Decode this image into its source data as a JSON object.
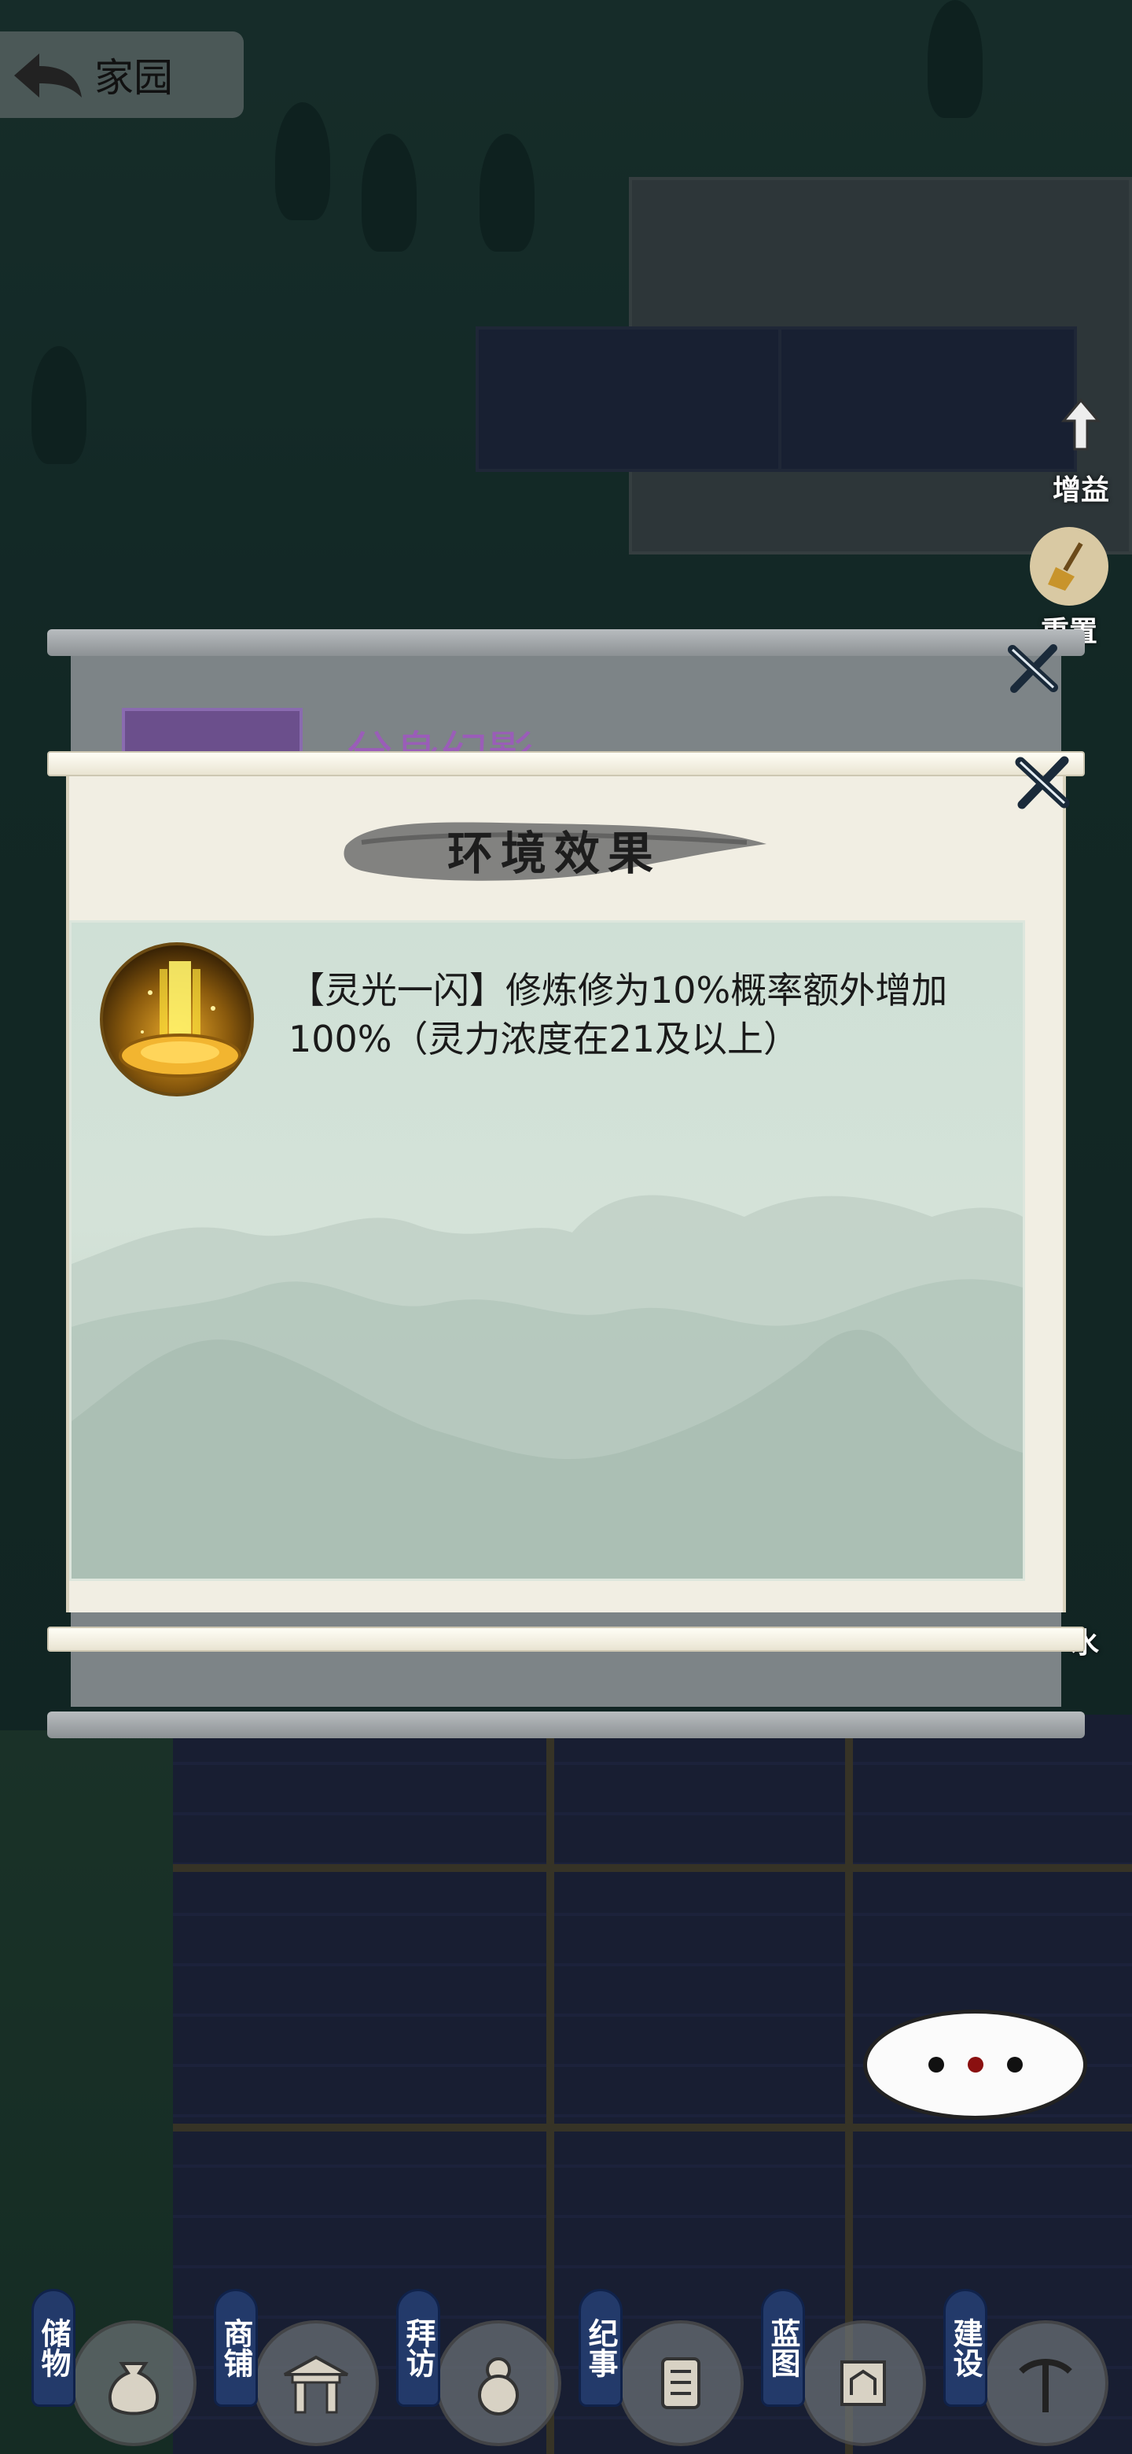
{
  "topbar": {
    "title": "家园"
  },
  "side_tools": {
    "buff_label": "增益",
    "reset_label": "重置",
    "water_label": "水"
  },
  "back_dialog": {
    "header_text": "分身幻影"
  },
  "dialog": {
    "title": "环境效果",
    "effect": {
      "icon": "golden-light-icon",
      "text": "【灵光一闪】修炼修为10%概率额外增加100%（灵力浓度在21及以上）"
    }
  },
  "bottom_nav": [
    {
      "label": "储物",
      "icon": "bag-icon"
    },
    {
      "label": "商铺",
      "icon": "shop-icon"
    },
    {
      "label": "拜访",
      "icon": "gourd-icon"
    },
    {
      "label": "纪事",
      "icon": "scroll-icon"
    },
    {
      "label": "蓝图",
      "icon": "blueprint-icon"
    },
    {
      "label": "建设",
      "icon": "pickaxe-icon"
    }
  ],
  "colors": {
    "accent": "#233a6a",
    "paper": "#f1eee3",
    "panel": "#cfe0d6"
  }
}
